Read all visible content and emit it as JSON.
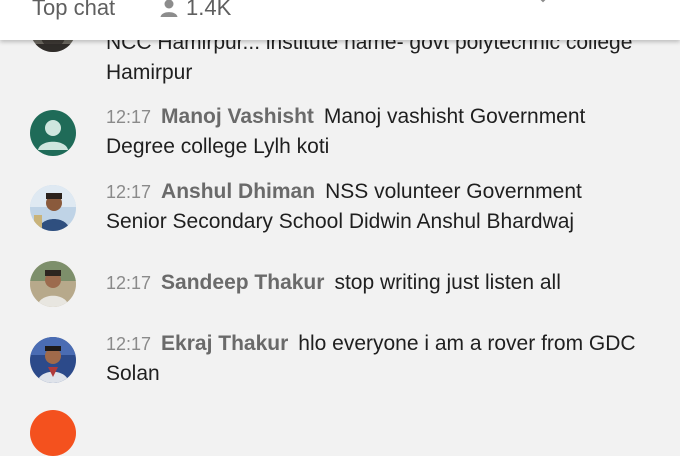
{
  "header": {
    "title": "Top chat",
    "viewer_count": "1.4K"
  },
  "messages": [
    {
      "text": "NCC Hamirpur... institute name- govt polytechnic college Hamirpur"
    },
    {
      "time": "12:17",
      "author": "Manoj Vashisht",
      "text": "Manoj vashisht Government Degree college Lylh koti"
    },
    {
      "time": "12:17",
      "author": "Anshul Dhiman",
      "text": "NSS volunteer Government Senior Secondary School Didwin Anshul Bhardwaj"
    },
    {
      "time": "12:17",
      "author": "Sandeep Thakur",
      "text": "stop writing just listen all"
    },
    {
      "time": "12:17",
      "author": "Ekraj Thakur",
      "text": "hlo everyone i am a rover from GDC Solan"
    }
  ],
  "colors": {
    "default_avatar": "#1f6b58",
    "next_avatar": "#f4511e"
  }
}
